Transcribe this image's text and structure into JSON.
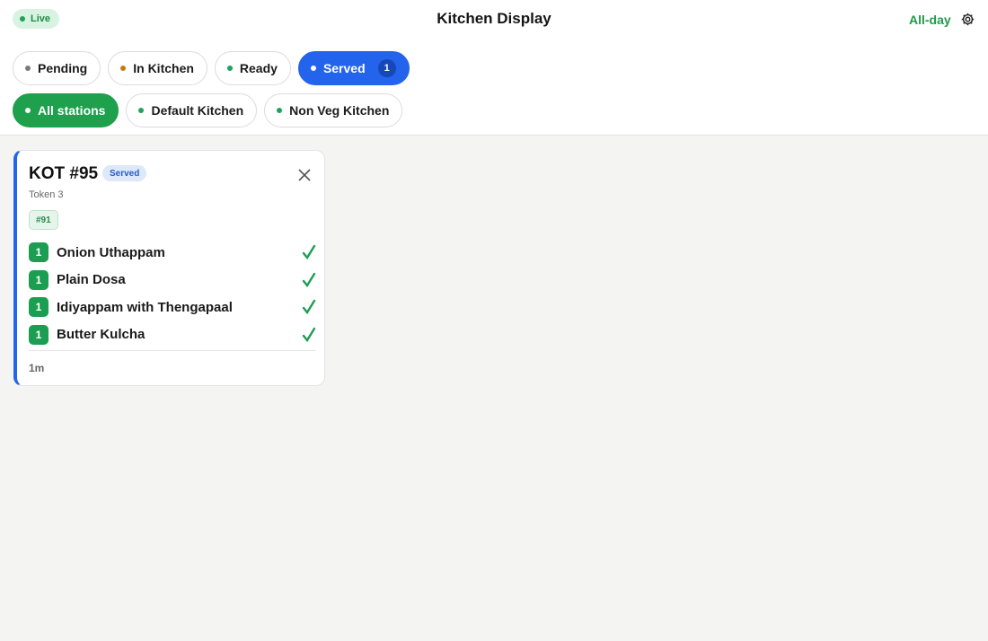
{
  "header": {
    "live_label": "Live",
    "title": "Kitchen Display",
    "allday_label": "All-day",
    "settings_icon": "gear-icon"
  },
  "status_filters": [
    {
      "label": "Pending",
      "dot_color": "#7a7a7a",
      "active": false
    },
    {
      "label": "In Kitchen",
      "dot_color": "#c8790f",
      "active": false
    },
    {
      "label": "Ready",
      "dot_color": "#1fa35a",
      "active": false
    },
    {
      "label": "Served",
      "dot_color": "#ffffff",
      "active": true,
      "count": "1"
    }
  ],
  "station_filters": [
    {
      "label": "All stations",
      "dot_color": "#ffffff",
      "active": true
    },
    {
      "label": "Default Kitchen",
      "dot_color": "#1fa35a",
      "active": false
    },
    {
      "label": "Non Veg Kitchen",
      "dot_color": "#1fa35a",
      "active": false
    }
  ],
  "kot": {
    "title": "KOT #95",
    "status": "Served",
    "token": "Token 3",
    "order_ref": "#91",
    "elapsed": "1m",
    "items": [
      {
        "qty": "1",
        "name": "Onion Uthappam"
      },
      {
        "qty": "1",
        "name": "Plain Dosa"
      },
      {
        "qty": "1",
        "name": "Idiyappam with Thengapaal"
      },
      {
        "qty": "1",
        "name": "Butter Kulcha"
      }
    ]
  },
  "colors": {
    "accent_blue": "#2463eb",
    "accent_green": "#1ea04d",
    "check_green": "#1c9e52"
  }
}
